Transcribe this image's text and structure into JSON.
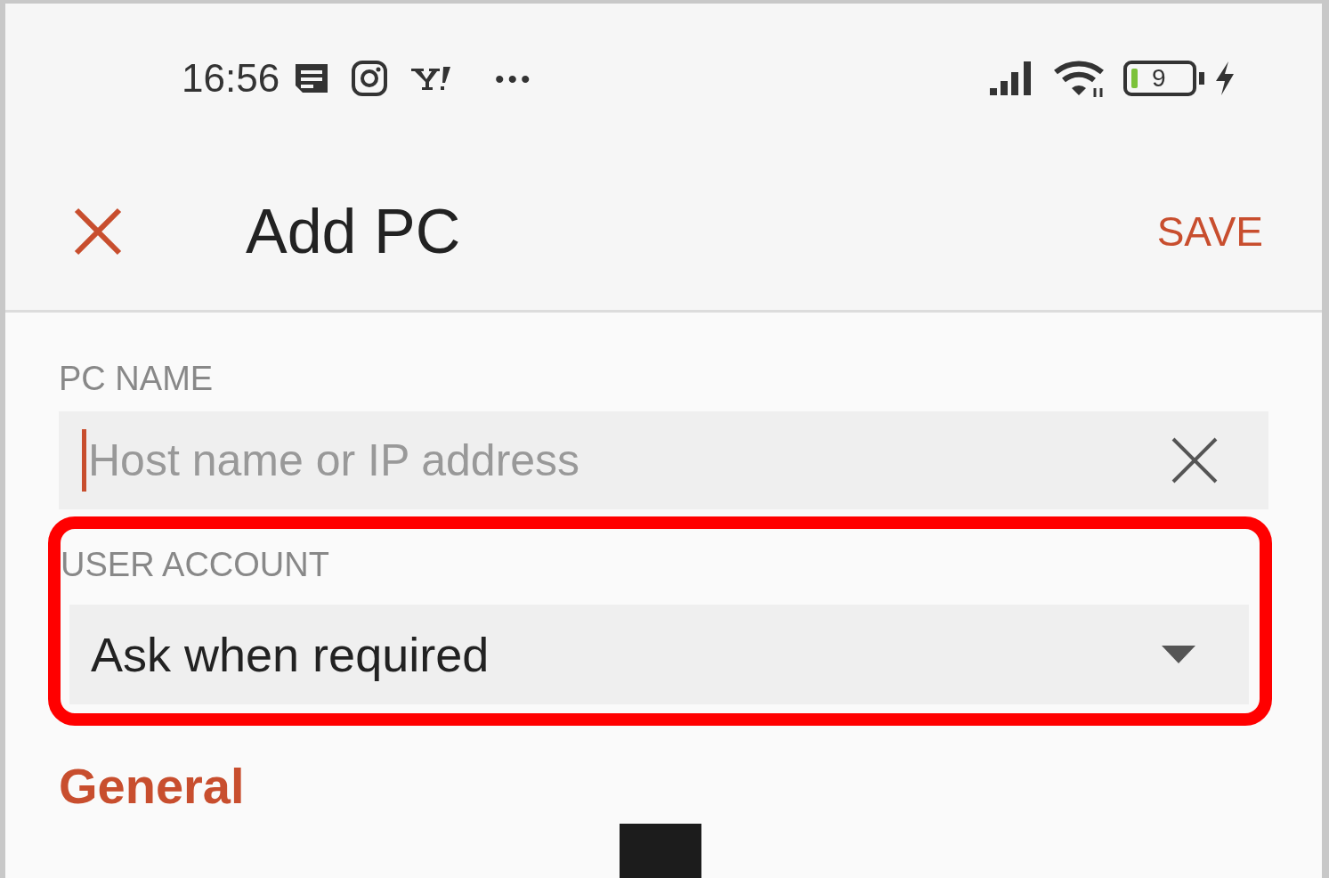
{
  "status_bar": {
    "time": "16:56",
    "more": "•••",
    "battery": "9"
  },
  "header": {
    "title": "Add PC",
    "action": "SAVE"
  },
  "pc_name": {
    "label": "PC NAME",
    "placeholder": "Host name or IP address"
  },
  "user_account": {
    "label": "USER ACCOUNT",
    "value": "Ask when required",
    "highlighted": true
  },
  "section": {
    "title": "General"
  }
}
